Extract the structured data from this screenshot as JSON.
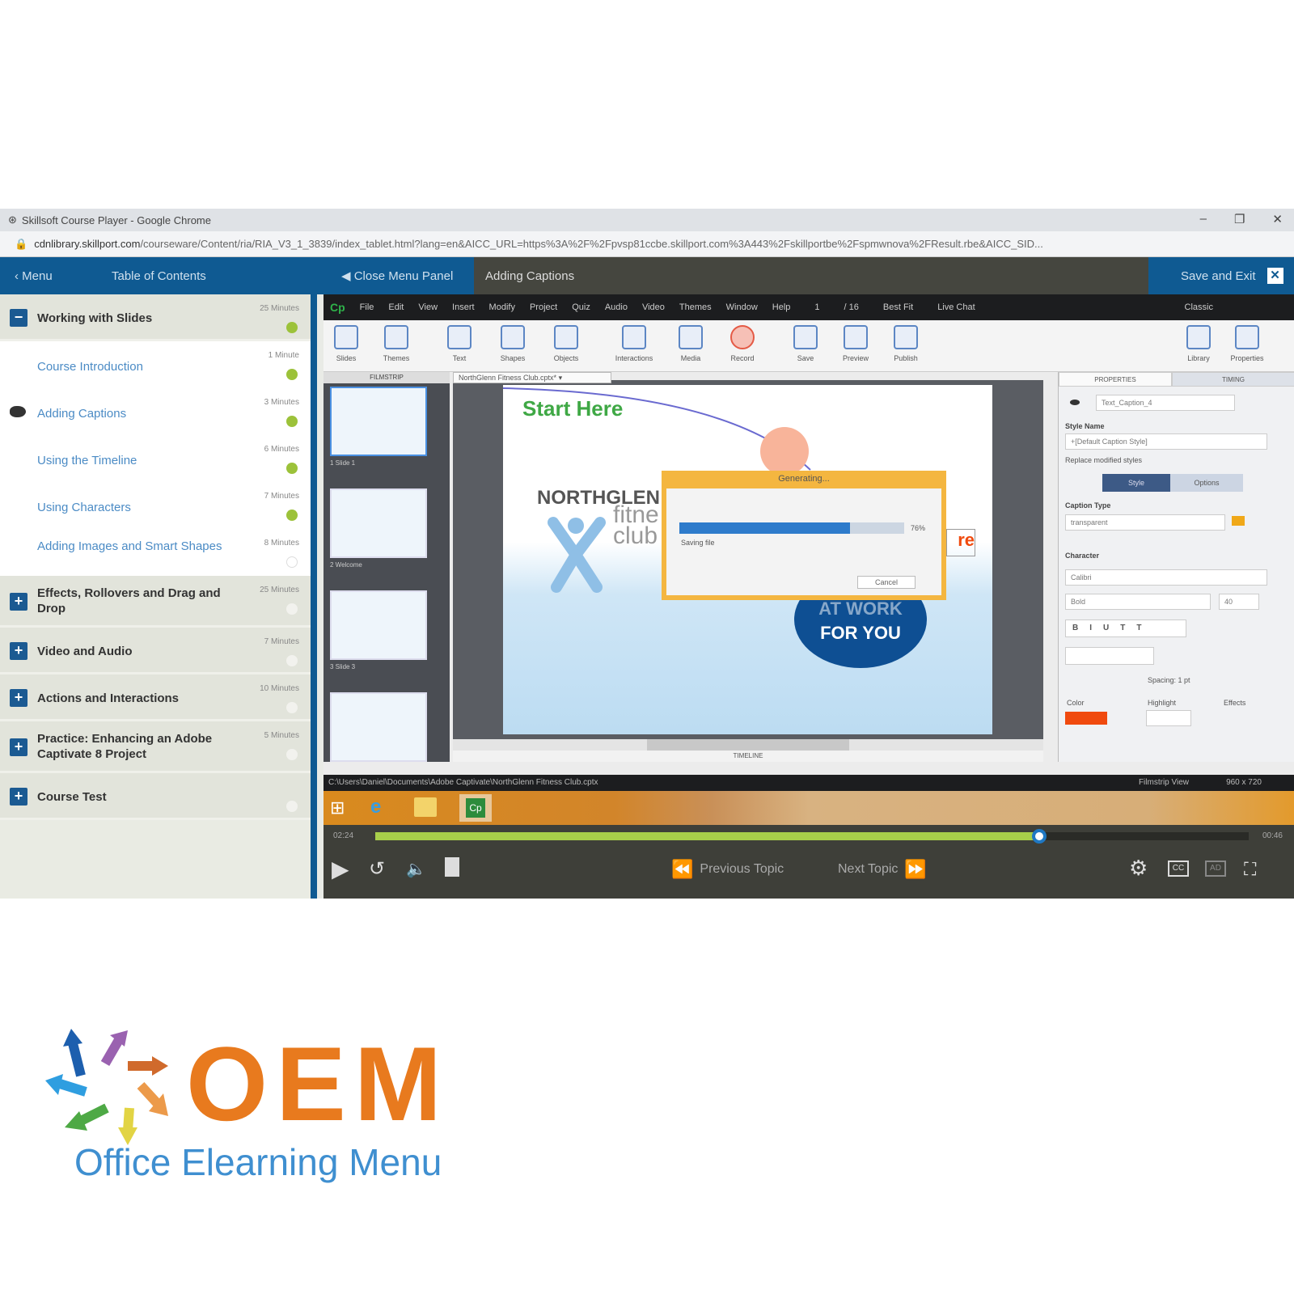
{
  "browser": {
    "window_title": "Skillsoft Course Player - Google Chrome",
    "url_domain": "cdnlibrary.skillport.com",
    "url_path": "/courseware/Content/ria/RIA_V3_1_3839/index_tablet.html?lang=en&AICC_URL=https%3A%2F%2Fpvsp81ccbe.skillport.com%3A443%2Fskillportbe%2Fspmwnova%2FResult.rbe&AICC_SID..."
  },
  "nav": {
    "menu_label": "Menu",
    "toc_label": "Table of Contents",
    "close_panel_label": "Close Menu Panel",
    "current_topic": "Adding Captions",
    "save_exit_label": "Save and Exit"
  },
  "toc": {
    "sections": [
      {
        "title": "Working with Slides",
        "duration": "25 Minutes",
        "expanded": true,
        "status": "partial",
        "topics": [
          {
            "title": "Course Introduction",
            "duration": "1 Minute",
            "status": "complete"
          },
          {
            "title": "Adding Captions",
            "duration": "3 Minutes",
            "status": "complete",
            "current": true
          },
          {
            "title": "Using the Timeline",
            "duration": "6 Minutes",
            "status": "complete"
          },
          {
            "title": "Using Characters",
            "duration": "7 Minutes",
            "status": "complete"
          },
          {
            "title": "Adding Images and Smart Shapes",
            "duration": "8 Minutes",
            "status": "not-started"
          }
        ]
      },
      {
        "title": "Effects, Rollovers and Drag and Drop",
        "duration": "25 Minutes",
        "expanded": false
      },
      {
        "title": "Video and Audio",
        "duration": "7 Minutes",
        "expanded": false
      },
      {
        "title": "Actions and Interactions",
        "duration": "10 Minutes",
        "expanded": false
      },
      {
        "title": "Practice: Enhancing an Adobe Captivate 8 Project",
        "duration": "5 Minutes",
        "expanded": false
      },
      {
        "title": "Course Test",
        "duration": "",
        "expanded": false
      }
    ]
  },
  "captivate": {
    "logo": "Cp",
    "menu": [
      "File",
      "Edit",
      "View",
      "Insert",
      "Modify",
      "Project",
      "Quiz",
      "Audio",
      "Video",
      "Themes",
      "Window",
      "Help"
    ],
    "page": "1",
    "page_total": "/ 16",
    "fit": "Best Fit",
    "live_chat": "Live Chat",
    "workspace": "Classic",
    "ribbon": [
      "Slides",
      "Themes",
      "Text",
      "Shapes",
      "Objects",
      "Interactions",
      "Media",
      "Record",
      "Save",
      "Preview",
      "Publish"
    ],
    "ribbon_right": [
      "Library",
      "Properties"
    ],
    "filmstrip_label": "FILMSTRIP",
    "doc_tab": "NorthGlenn Fitness Club.cptx*",
    "thumb_labels": [
      "1 Slide 1",
      "2 Welcome",
      "3 Slide 3"
    ],
    "timeline_label": "TIMELINE",
    "slide": {
      "start_here": "Start Here",
      "brand_1": "NORTHGLEN",
      "brand_2": "fitne",
      "brand_3": "club",
      "circle_1": "AT WORK",
      "circle_2": "FOR YOU",
      "caption_fragment": "re"
    },
    "dialog": {
      "title": "Generating...",
      "progress_percent": 76,
      "progress_label": "76%",
      "status": "Saving file",
      "cancel": "Cancel"
    },
    "properties": {
      "tabs": [
        "PROPERTIES",
        "TIMING"
      ],
      "object_name": "Text_Caption_4",
      "style_name_label": "Style Name",
      "style_name": "+[Default Caption Style]",
      "replace_styles": "Replace modified styles",
      "subtabs": [
        "Style",
        "Options"
      ],
      "caption_type_label": "Caption Type",
      "caption_type": "transparent",
      "character_label": "Character",
      "font": "Calibri",
      "font_style": "Bold",
      "font_size": "40",
      "spacing": "Spacing: 1 pt",
      "color_label": "Color",
      "highlight_label": "Highlight",
      "effects_label": "Effects",
      "text_color": "#f04a0e"
    },
    "status_path": "C:\\Users\\Daniel\\Documents\\Adobe Captivate\\NorthGlenn Fitness Club.cptx",
    "status_view": "Filmstrip View",
    "status_size": "960 x 720"
  },
  "player": {
    "elapsed": "02:24",
    "total": "00:46",
    "progress_percent": 76,
    "previous": "Previous Topic",
    "next": "Next Topic"
  },
  "logo": {
    "letters": "OEM",
    "tagline": "Office Elearning Menu",
    "orange": "#e87a1e",
    "blue": "#3f8fd0"
  },
  "colors": {
    "nav_blue": "#0f5a92",
    "complete_green": "#9cc23a",
    "progress_green": "#a8cf4a"
  }
}
